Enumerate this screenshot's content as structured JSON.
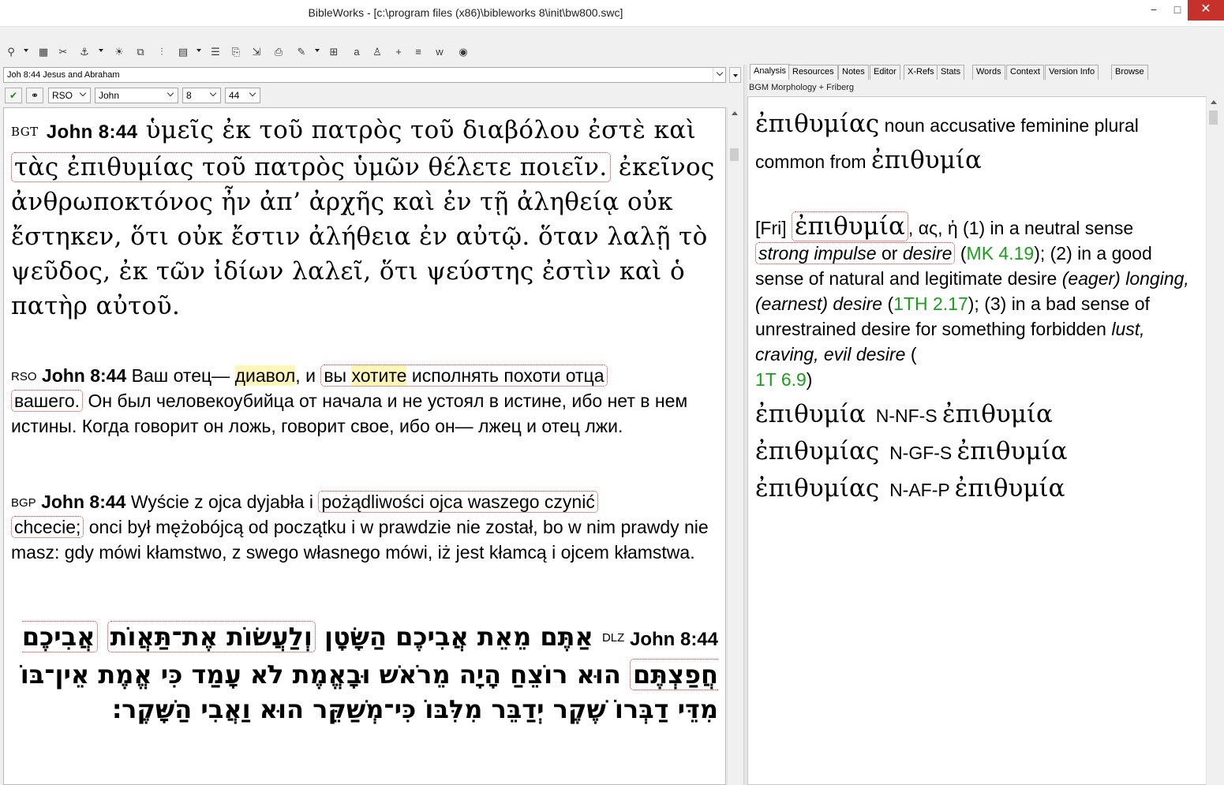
{
  "window": {
    "title": "BibleWorks - [c:\\program files (x86)\\bibleworks 8\\init\\bw800.swc]",
    "minimize": "−",
    "maximize": "□",
    "close": "✕"
  },
  "toolbar": {
    "icons": [
      "search-icon",
      "browse-icon",
      "tools-icon",
      "bookmark-icon",
      "highlight-icon",
      "window-icon",
      "columns-icon",
      "grid-icon",
      "list-icon",
      "copy-icon",
      "export-icon",
      "print-icon",
      "highlighter-icon",
      "layout-icon",
      "font-icon",
      "user-icon",
      "plus-icon",
      "text-icon",
      "word-icon",
      "globe-icon"
    ]
  },
  "left": {
    "reference_bar": "Joh 8:44 Jesus and Abraham",
    "version": "RSO",
    "book": "John",
    "chapter": "8",
    "verse": "44",
    "verses": {
      "bgt": {
        "version": "BGT",
        "ref": "John 8:44",
        "pre": "ὑμεῖς ἐκ τοῦ πατρὸς τοῦ διαβόλου ἐστὲ καὶ ",
        "boxed": "τὰς ἐπιθυμίας τοῦ πατρὸς ὑμῶν θέλετε ποιεῖν.",
        "post": " ἐκεῖνος ἀνθρωποκτόνος ἦν ἀπ’ ἀρχῆς καὶ ἐν τῇ ἀληθείᾳ οὐκ ἔστηκεν, ὅτι οὐκ ἔστιν ἀλήθεια ἐν αὐτῷ. ὅταν λαλῇ τὸ ψεῦδος, ἐκ τῶν ἰδίων λαλεῖ, ὅτι ψεύστης ἐστὶν καὶ ὁ πατὴρ αὐτοῦ."
      },
      "rso": {
        "version": "RSO",
        "ref": "John 8:44",
        "t1": " Ваш отец— ",
        "hl1": "диавол",
        "t2": ", и ",
        "box1_a": "вы ",
        "hl2": "хотите",
        "box1_b": " исполнять похоти отца",
        "box2": "вашего.",
        "t3": " Он был человекоубийца от начала и не устоял в истине, ибо нет в нем истины. Когда говорит он ложь, говорит свое, ибо он— лжец и отец лжи."
      },
      "bgp": {
        "version": "BGP",
        "ref": "John 8:44",
        "t1": " Wyście z ojca dyjabła i ",
        "box1": "pożądliwości ojca waszego czynić",
        "box2": "chcecie;",
        "t2": " onci był mężobójcą od początku i w prawdzie nie został, bo w nim prawdy nie masz: gdy mówi kłamstwo, z swego własnego mówi, iż jest kłamcą i ojcem kłamstwa."
      },
      "dlz": {
        "version": "DLZ",
        "ref": "John 8:44",
        "t1": "אַתֶּם מֵאֵת אֲבִיכֶם הַשָּׂטָן ",
        "box1": "וְלַעֲשׂוֹת אֶת־תַּאֲוֹת",
        "box2": "אֲבִיכֶם חֲפַצְתֶּם",
        "t2": " הוּא רוֹצֵחַ הָיָה מֵרֹאשׁ וּבָאֱמֶת לֹא עָמַד כִּי אֱמֶת אֵין־בּוֹ מִדֵּי דַבְּרוֹ שֶׁקֶר יְדַבֵּר מִלִּבּוֹ כִּי־מְשַׁקֵּר הוּא וַאֲבִי הַשָּׁקֶר׃"
      }
    }
  },
  "right": {
    "tabs": [
      "Analysis",
      "Resources",
      "Notes",
      "Editor",
      "X-Refs",
      "Stats",
      "Words",
      "Context",
      "Version Info",
      "Browse"
    ],
    "active_tab": "Analysis",
    "panel_title": "BGM Morphology + Friberg",
    "analysis": {
      "head_word": "ἐπιθυμίας",
      "head_desc": " noun accusative feminine plural common from ",
      "head_lemma": "ἐπιθυμία",
      "fri_label": "[Fri]",
      "fri_word": "ἐπιθυμία",
      "fri_forms": ", ας, ἡ",
      "d1": "  (1) in a neutral sense ",
      "d1_box_a": "strong impulse",
      "d1_box_or": " or ",
      "d1_box_b": "desire",
      "ref1": "MK 4.19",
      "d2": "); (2) in a good sense of natural and legitimate desire ",
      "d2_it": "(eager) longing, (earnest) desire",
      "ref2": "1TH 2.17",
      "d3": "); (3) in a bad sense of unrestrained desire for something forbidden ",
      "d3_it": "lust, craving, evil desire",
      "ref3": "1T 6.9",
      "forms": [
        {
          "word": "ἐπιθυμία",
          "parse": "N-NF-S",
          "lemma": "ἐπιθυμία"
        },
        {
          "word": "ἐπιθυμίας",
          "parse": "N-GF-S",
          "lemma": "ἐπιθυμία"
        },
        {
          "word": "ἐπιθυμίας",
          "parse": "N-AF-P",
          "lemma": "ἐπιθυμία"
        }
      ]
    }
  },
  "colors": {
    "highlight": "#fff6b8",
    "box": "#e02020",
    "reference_link": "#1aa01a",
    "close_button": "#c7312b"
  }
}
